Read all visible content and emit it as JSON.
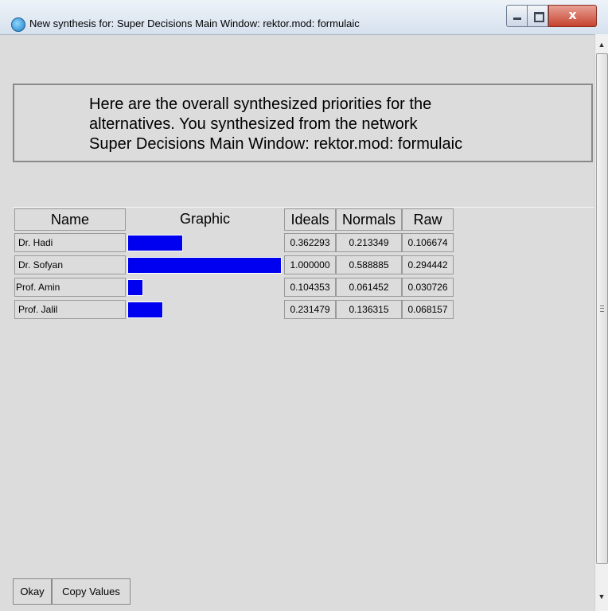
{
  "window": {
    "title": "New synthesis for: Super Decisions Main Window: rektor.mod: formulaic",
    "icon": "refresh-app-icon",
    "controls": {
      "minimize": "minimize-icon",
      "maximize": "maximize-icon",
      "close": "x"
    }
  },
  "message": {
    "line1": "Here are the overall synthesized priorities for the",
    "line2": "alternatives.  You synthesized from the network",
    "line3": "Super Decisions Main Window: rektor.mod: formulaic"
  },
  "table": {
    "headers": {
      "name": "Name",
      "graphic": "Graphic",
      "ideals": "Ideals",
      "normals": "Normals",
      "raw": "Raw"
    },
    "rows": [
      {
        "name": "Dr. Hadi",
        "ideals": "0.362293",
        "normals": "0.213349",
        "raw": "0.106674",
        "ideal_value": 0.362293
      },
      {
        "name": "Dr. Sofyan",
        "ideals": "1.000000",
        "normals": "0.588885",
        "raw": "0.294442",
        "ideal_value": 1.0
      },
      {
        "name": "Prof. Amin",
        "ideals": "0.104353",
        "normals": "0.061452",
        "raw": "0.030726",
        "ideal_value": 0.104353
      },
      {
        "name": " Prof. Jalil",
        "ideals": "0.231479",
        "normals": "0.136315",
        "raw": "0.068157",
        "ideal_value": 0.231479
      }
    ],
    "bar_color": "#0000f0"
  },
  "buttons": {
    "okay": "Okay",
    "copy": "Copy Values"
  }
}
